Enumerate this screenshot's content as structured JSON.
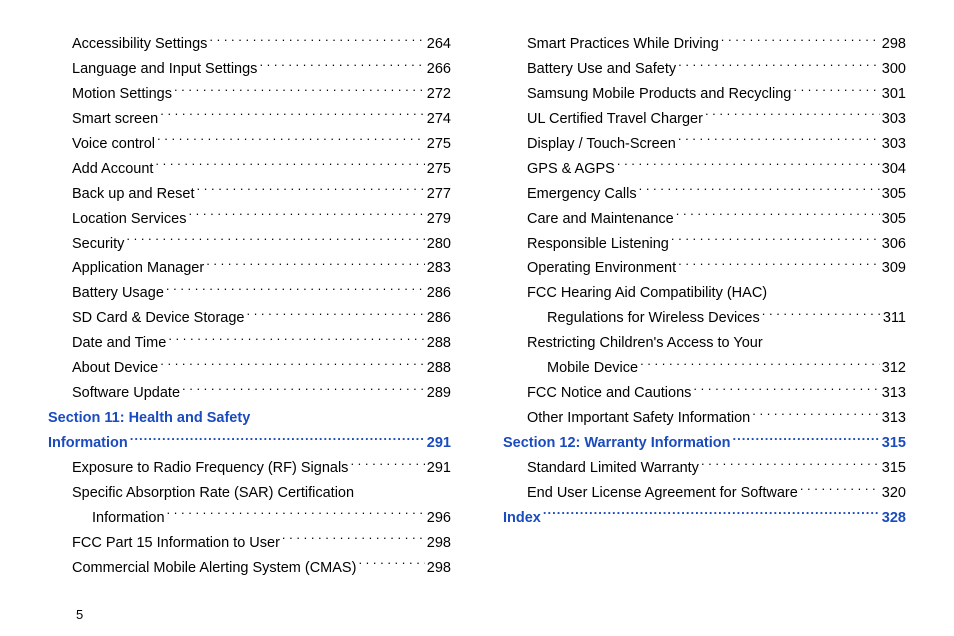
{
  "pageNumber": "5",
  "leftColumn": [
    {
      "type": "entry",
      "indent": 1,
      "label": "Accessibility Settings",
      "page": "264"
    },
    {
      "type": "entry",
      "indent": 1,
      "label": "Language and Input Settings",
      "page": "266"
    },
    {
      "type": "entry",
      "indent": 1,
      "label": "Motion Settings",
      "page": "272"
    },
    {
      "type": "entry",
      "indent": 1,
      "label": "Smart screen ",
      "page": "274"
    },
    {
      "type": "entry",
      "indent": 1,
      "label": "Voice control",
      "page": "275"
    },
    {
      "type": "entry",
      "indent": 1,
      "label": "Add Account ",
      "page": "275"
    },
    {
      "type": "entry",
      "indent": 1,
      "label": "Back up and Reset ",
      "page": "277"
    },
    {
      "type": "entry",
      "indent": 1,
      "label": "Location Services ",
      "page": "279"
    },
    {
      "type": "entry",
      "indent": 1,
      "label": "Security",
      "page": "280"
    },
    {
      "type": "entry",
      "indent": 1,
      "label": "Application Manager",
      "page": "283"
    },
    {
      "type": "entry",
      "indent": 1,
      "label": "Battery Usage",
      "page": "286"
    },
    {
      "type": "entry",
      "indent": 1,
      "label": "SD Card & Device Storage",
      "page": "286"
    },
    {
      "type": "entry",
      "indent": 1,
      "label": "Date and Time",
      "page": "288"
    },
    {
      "type": "entry",
      "indent": 1,
      "label": "About Device",
      "page": "288"
    },
    {
      "type": "entry",
      "indent": 1,
      "label": "Software Update",
      "page": "289"
    },
    {
      "type": "section-start",
      "label": "Section 11:  Health and Safety"
    },
    {
      "type": "section-end",
      "label": "Information",
      "page": "291"
    },
    {
      "type": "entry",
      "indent": 1,
      "label": "Exposure to Radio Frequency (RF) Signals",
      "page": "291"
    },
    {
      "type": "wrap",
      "indent": 1,
      "label": "Specific Absorption Rate (SAR) Certification"
    },
    {
      "type": "entry",
      "indent": 2,
      "label": "Information ",
      "page": "296"
    },
    {
      "type": "entry",
      "indent": 1,
      "label": "FCC Part 15 Information to User ",
      "page": "298"
    },
    {
      "type": "entry",
      "indent": 1,
      "label": "Commercial Mobile Alerting System (CMAS) ",
      "page": "298"
    }
  ],
  "rightColumn": [
    {
      "type": "entry",
      "indent": 1,
      "label": "Smart Practices While Driving",
      "page": "298"
    },
    {
      "type": "entry",
      "indent": 1,
      "label": "Battery Use and Safety ",
      "page": "300"
    },
    {
      "type": "entry",
      "indent": 1,
      "label": "Samsung Mobile Products and Recycling",
      "page": "301"
    },
    {
      "type": "entry",
      "indent": 1,
      "label": "UL Certified Travel Charger",
      "page": "303"
    },
    {
      "type": "entry",
      "indent": 1,
      "label": "Display / Touch-Screen",
      "page": "303"
    },
    {
      "type": "entry",
      "indent": 1,
      "label": "GPS & AGPS ",
      "page": "304"
    },
    {
      "type": "entry",
      "indent": 1,
      "label": "Emergency Calls",
      "page": "305"
    },
    {
      "type": "entry",
      "indent": 1,
      "label": "Care and Maintenance",
      "page": "305"
    },
    {
      "type": "entry",
      "indent": 1,
      "label": "Responsible Listening",
      "page": "306"
    },
    {
      "type": "entry",
      "indent": 1,
      "label": "Operating Environment ",
      "page": "309"
    },
    {
      "type": "wrap",
      "indent": 1,
      "label": "FCC Hearing Aid Compatibility (HAC)"
    },
    {
      "type": "entry",
      "indent": 2,
      "label": "Regulations for Wireless Devices",
      "page": "311"
    },
    {
      "type": "wrap",
      "indent": 1,
      "label": "Restricting Children's Access to Your"
    },
    {
      "type": "entry",
      "indent": 2,
      "label": "Mobile Device ",
      "page": "312"
    },
    {
      "type": "entry",
      "indent": 1,
      "label": "FCC Notice and Cautions",
      "page": "313"
    },
    {
      "type": "entry",
      "indent": 1,
      "label": "Other Important Safety Information ",
      "page": "313"
    },
    {
      "type": "section-end",
      "label": "Section 12:  Warranty Information ",
      "page": "315"
    },
    {
      "type": "entry",
      "indent": 1,
      "label": "Standard Limited Warranty ",
      "page": "315"
    },
    {
      "type": "entry",
      "indent": 1,
      "label": "End User License Agreement for Software",
      "page": "320"
    },
    {
      "type": "section-end",
      "label": "Index ",
      "page": "328"
    }
  ]
}
